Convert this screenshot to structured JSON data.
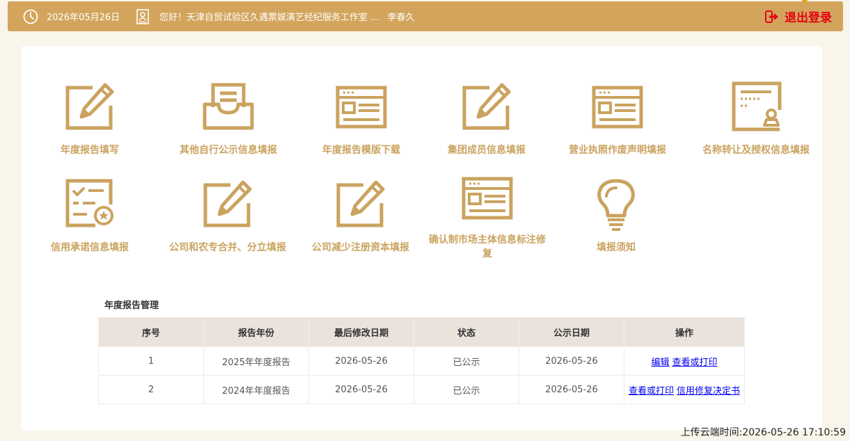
{
  "header": {
    "date": "2026年05月26日",
    "greeting": "您好！天津自贸试验区久遇票娱演艺经纪服务工作室 ...",
    "user_name": "李春久",
    "logout_label": "退出登录",
    "bar_color": "#d3a55c"
  },
  "tiles": [
    {
      "label": "年度报告填写",
      "icon": "edit-form-icon"
    },
    {
      "label": "其他自行公示信息填报",
      "icon": "inbox-tray-icon"
    },
    {
      "label": "年度报告模版下载",
      "icon": "document-template-icon"
    },
    {
      "label": "集团成员信息填报",
      "icon": "edit-form-icon"
    },
    {
      "label": "营业执照作废声明填报",
      "icon": "document-template-icon"
    },
    {
      "label": "名称转让及授权信息填报",
      "icon": "certificate-stamp-icon"
    },
    {
      "label": "信用承诺信息填报",
      "icon": "checklist-badge-icon"
    },
    {
      "label": "公司和农专合并、分立填报",
      "icon": "edit-form-icon"
    },
    {
      "label": "公司减少注册资本填报",
      "icon": "edit-form-icon"
    },
    {
      "label": "确认制市场主体信息标注修复",
      "icon": "document-template-icon"
    },
    {
      "label": "填报须知",
      "icon": "lightbulb-icon"
    }
  ],
  "management": {
    "title": "年度报告管理",
    "columns": [
      "序号",
      "报告年份",
      "最后修改日期",
      "状态",
      "公示日期",
      "操作"
    ],
    "rows": [
      {
        "no": "1",
        "year": "2025年年度报告",
        "modified": "2026-05-26",
        "status": "已公示",
        "published": "2026-05-26",
        "actions": [
          "编辑",
          "查看或打印"
        ]
      },
      {
        "no": "2",
        "year": "2024年年度报告",
        "modified": "2026-05-26",
        "status": "已公示",
        "published": "2026-05-26",
        "actions": [
          "查看或打印",
          "信用修复决定书"
        ]
      }
    ]
  },
  "upload_time": "上传云端时间:2026-05-26 17:10:59",
  "accent_color": "#caa35f",
  "link_color": "#0000ee",
  "logout_color": "#e60012"
}
